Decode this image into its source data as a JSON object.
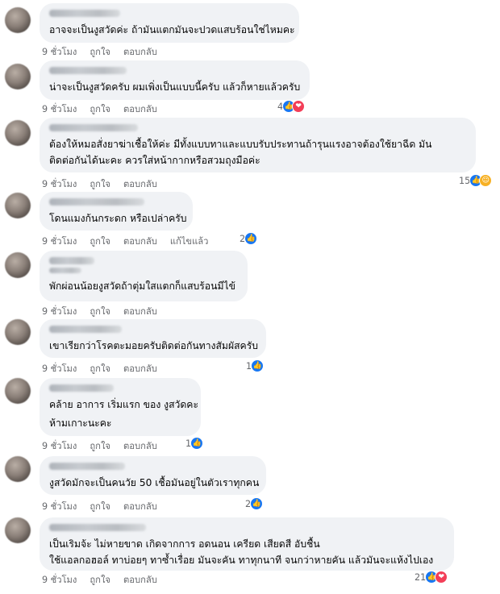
{
  "action_like": "ถูกใจ",
  "action_reply": "ตอบกลับ",
  "comments": [
    {
      "time": "9 ชั่วโมง",
      "lines": [
        "อาจจะเป็นงูสวัดค่ะ ถ้ามันแตกมันจะปวดแสบร้อนใช่ไหมคะ"
      ],
      "reactions": "",
      "edited": ""
    },
    {
      "time": "9 ชั่วโมง",
      "lines": [
        "น่าจะเป็นงูสวัดครับ ผมเพิ่งเป็นแบบนี้ครับ แล้วก็หายแล้วครับ"
      ],
      "reactions": "4",
      "edited": ""
    },
    {
      "time": "9 ชั่วโมง",
      "lines": [
        "ต้องให้หมอสั่งยาฆ่าเชื้อให้ค่ะ มีทั้งแบบทาและแบบรับประทานถ้ารุนแรงอาจต้องใช้ยาฉีด มัน",
        "ติดต่อกันได้นะคะ ควรใส่หน้ากากหรือสวมถุงมือค่ะ"
      ],
      "reactions": "15",
      "edited": ""
    },
    {
      "time": "9 ชั่วโมง",
      "lines": [
        "โดนแมงก้นกระดก หรือเปล่าครับ"
      ],
      "reactions": "2",
      "edited": "แก้ไขแล้ว"
    },
    {
      "time": "9 ชั่วโมง",
      "lines": [
        "พักผ่อนน้อยงูสวัดถ้าตุ่มใสแตกก็แสบร้อนมีไข้"
      ],
      "reactions": "",
      "edited": ""
    },
    {
      "time": "9 ชั่วโมง",
      "lines": [
        "เขาเรียกว่าโรคตะมอยครับติดต่อกันทางสัมผัสครับ"
      ],
      "reactions": "1",
      "edited": ""
    },
    {
      "time": "9 ชั่วโมง",
      "lines": [
        "คล้าย อาการ เริ่มแรก ของ งูสวัดคะ",
        "ห้ามเกาะนะคะ"
      ],
      "reactions": "1",
      "edited": ""
    },
    {
      "time": "9 ชั่วโมง",
      "lines": [
        "งูสวัดมักจะเป็นคนวัย 50 เชื้อมันอยู่ในตัวเราทุกคน"
      ],
      "reactions": "2",
      "edited": ""
    },
    {
      "time": "9 ชั่วโมง",
      "lines": [
        "เป็นเริมจ้ะ ไม่หายขาด เกิดจากการ อดนอน เครียด เสียดสี อับชื้น",
        "ใช้แอลกอฮอล์ ทาบ่อยๆ ทาซ้ำเรื่อย มันจะคัน ทาทุกนาที จนกว่าหายคัน แล้วมันจะแห้งไปเอง"
      ],
      "reactions": "21",
      "edited": ""
    }
  ]
}
